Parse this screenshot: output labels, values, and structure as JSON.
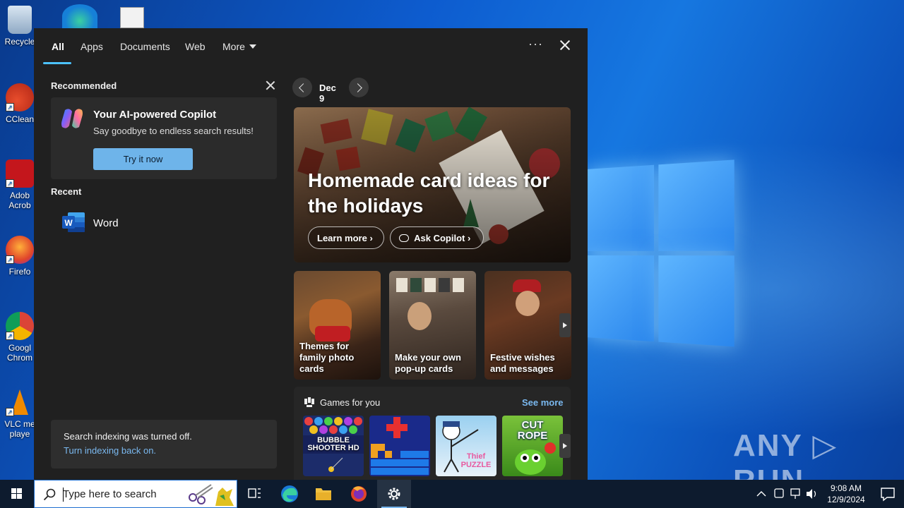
{
  "desktop": {
    "icons": [
      {
        "label": "Recycle",
        "icon": "recycle-bin-icon"
      },
      {
        "label": "CClean",
        "icon": "ccleaner-icon"
      },
      {
        "label": "Adob\nAcrob",
        "icon": "adobe-acrobat-icon"
      },
      {
        "label": "Firefo",
        "icon": "firefox-icon"
      },
      {
        "label": "Googl\nChrom",
        "icon": "chrome-icon"
      },
      {
        "label": "VLC me\nplaye",
        "icon": "vlc-icon"
      }
    ],
    "watermark": "ANY ▷ RUN"
  },
  "search_panel": {
    "tabs": [
      {
        "label": "All",
        "active": true
      },
      {
        "label": "Apps"
      },
      {
        "label": "Documents"
      },
      {
        "label": "Web"
      },
      {
        "label": "More"
      }
    ],
    "more_options_label": "···",
    "recommended": {
      "heading": "Recommended",
      "card": {
        "title": "Your AI-powered Copilot",
        "subtitle": "Say goodbye to endless search results!",
        "button": "Try it now"
      }
    },
    "recent": {
      "heading": "Recent",
      "items": [
        {
          "label": "Word",
          "icon": "word-icon"
        }
      ]
    },
    "indexing": {
      "message": "Search indexing was turned off.",
      "link": "Turn indexing back on."
    },
    "highlights": {
      "date": "Dec 9",
      "hero": {
        "title": "Homemade card ideas for the holidays",
        "learn_more": "Learn more",
        "ask_copilot": "Ask Copilot"
      },
      "tiles": [
        {
          "label": "Themes for family photo cards"
        },
        {
          "label": "Make your own pop-up cards"
        },
        {
          "label": "Festive wishes and messages"
        }
      ],
      "games": {
        "title": "Games for you",
        "see_more": "See more",
        "items": [
          {
            "name": "Bubble Shooter HD",
            "art_text": "BUBBLE\nSHOOTER HD"
          },
          {
            "name": "Blocks puzzle"
          },
          {
            "name": "Thief Puzzle",
            "art_text": "Thief\nPUZZLE"
          },
          {
            "name": "Cut the Rope",
            "art_text": "CUT\nROPE"
          }
        ]
      }
    }
  },
  "taskbar": {
    "search_placeholder": "Type here to search",
    "apps": [
      "task-view-icon",
      "edge-icon",
      "file-explorer-icon",
      "firefox-icon",
      "settings-icon"
    ],
    "clock_time": "9:08 AM",
    "clock_date": "12/9/2024"
  }
}
